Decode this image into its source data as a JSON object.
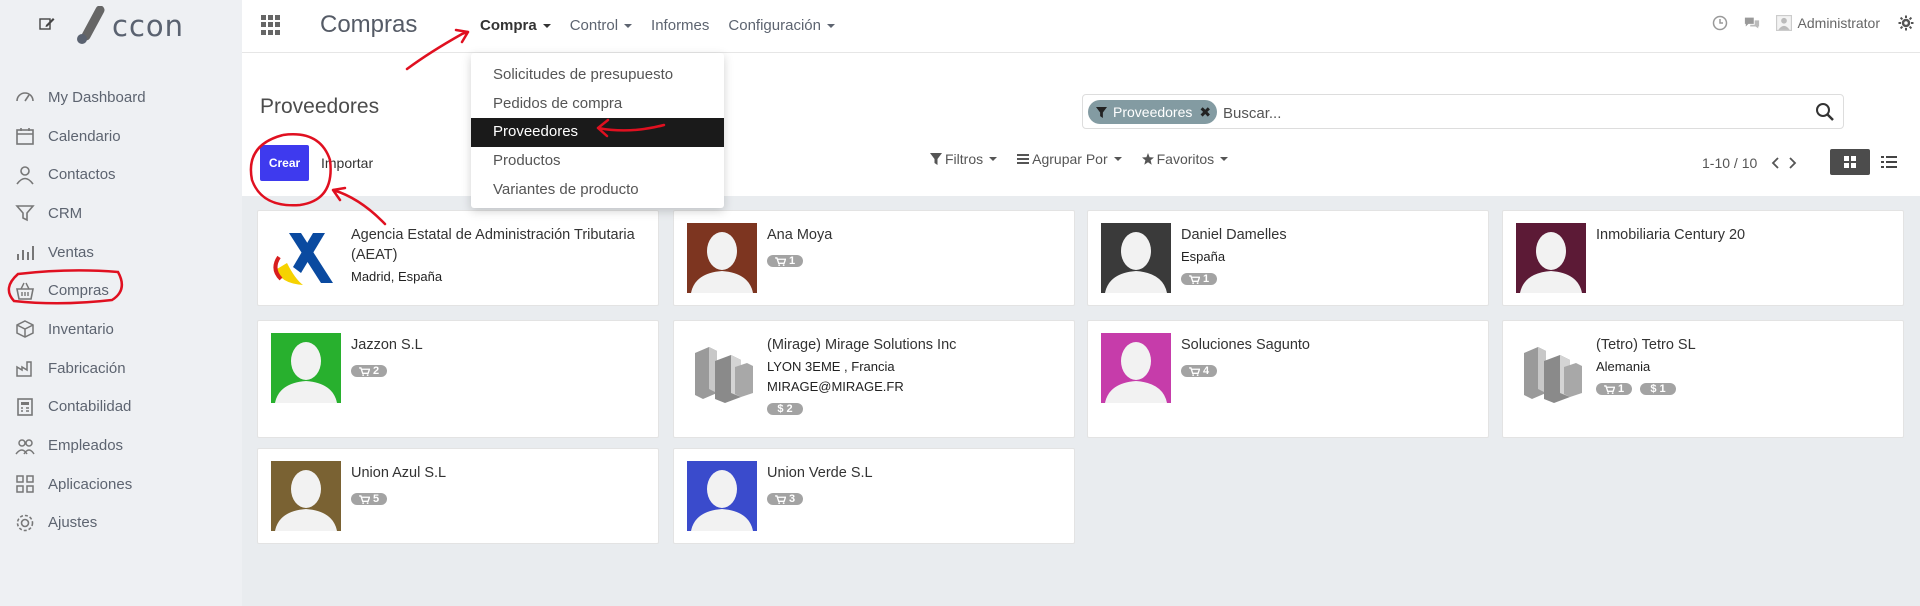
{
  "app": {
    "title": "Compras",
    "logo_text": "ccon"
  },
  "sidebar": {
    "items": [
      {
        "label": "My Dashboard",
        "icon": "dashboard-icon"
      },
      {
        "label": "Calendario",
        "icon": "calendar-icon"
      },
      {
        "label": "Contactos",
        "icon": "user-icon"
      },
      {
        "label": "CRM",
        "icon": "filter-icon"
      },
      {
        "label": "Ventas",
        "icon": "bar-chart-icon"
      },
      {
        "label": "Compras",
        "icon": "basket-icon"
      },
      {
        "label": "Inventario",
        "icon": "box-icon"
      },
      {
        "label": "Fabricación",
        "icon": "factory-icon"
      },
      {
        "label": "Contabilidad",
        "icon": "calculator-icon"
      },
      {
        "label": "Empleados",
        "icon": "users-icon"
      },
      {
        "label": "Aplicaciones",
        "icon": "apps-icon"
      },
      {
        "label": "Ajustes",
        "icon": "gear-icon"
      }
    ]
  },
  "topnav": {
    "items": [
      {
        "label": "Compra",
        "has_caret": true,
        "active": true
      },
      {
        "label": "Control",
        "has_caret": true
      },
      {
        "label": "Informes",
        "has_caret": false
      },
      {
        "label": "Configuración",
        "has_caret": true
      }
    ],
    "user": "Administrator"
  },
  "dropdown": {
    "items": [
      {
        "label": "Solicitudes de presupuesto"
      },
      {
        "label": "Pedidos de compra"
      },
      {
        "label": "Proveedores",
        "active": true
      },
      {
        "label": "Productos"
      },
      {
        "label": "Variantes de producto"
      }
    ]
  },
  "control": {
    "title": "Proveedores",
    "create_label": "Crear",
    "import_label": "Importar",
    "search_facet": "Proveedores",
    "search_placeholder": "Buscar...",
    "filters_label": "Filtros",
    "groupby_label": "Agrupar Por",
    "favorites_label": "Favoritos",
    "pager": "1-10 / 10"
  },
  "cards": [
    {
      "name": "Agencia Estatal de Administración Tributaria (AEAT)",
      "lines": [
        "Madrid, España"
      ],
      "badges": [],
      "avatar": "aeat",
      "color": "#ffffff"
    },
    {
      "name": "Ana Moya",
      "lines": [],
      "badges": [
        {
          "icon": "cart",
          "value": "1"
        }
      ],
      "avatar": "person",
      "color": "#7d3520"
    },
    {
      "name": "Daniel Damelles",
      "lines": [
        "España"
      ],
      "badges": [
        {
          "icon": "cart",
          "value": "1"
        }
      ],
      "avatar": "person",
      "color": "#3a3a3a"
    },
    {
      "name": "Inmobiliaria Century 20",
      "lines": [],
      "badges": [],
      "avatar": "person",
      "color": "#5c1a36"
    },
    {
      "name": "Jazzon S.L",
      "lines": [],
      "badges": [
        {
          "icon": "cart",
          "value": "2"
        }
      ],
      "avatar": "person",
      "color": "#28b02e"
    },
    {
      "name": "(Mirage) Mirage Solutions Inc",
      "lines": [
        "LYON 3EME , Francia",
        "MIRAGE@MIRAGE.FR"
      ],
      "badges": [
        {
          "icon": "dollar",
          "value": "2"
        }
      ],
      "avatar": "building",
      "color": "#ffffff"
    },
    {
      "name": "Soluciones Sagunto",
      "lines": [],
      "badges": [
        {
          "icon": "cart",
          "value": "4"
        }
      ],
      "avatar": "person",
      "color": "#c63caa"
    },
    {
      "name": "(Tetro) Tetro SL",
      "lines": [
        "Alemania"
      ],
      "badges": [
        {
          "icon": "cart",
          "value": "1"
        },
        {
          "icon": "dollar",
          "value": "1"
        }
      ],
      "avatar": "building",
      "color": "#ffffff"
    },
    {
      "name": "Union Azul S.L",
      "lines": [],
      "badges": [
        {
          "icon": "cart",
          "value": "5"
        }
      ],
      "avatar": "person",
      "color": "#7a6233"
    },
    {
      "name": "Union Verde S.L",
      "lines": [],
      "badges": [
        {
          "icon": "cart",
          "value": "3"
        }
      ],
      "avatar": "person",
      "color": "#3a4bcc"
    }
  ],
  "colors": {
    "primary": "#3e3aee",
    "annotation": "#e01020",
    "facet": "#839ba2"
  }
}
